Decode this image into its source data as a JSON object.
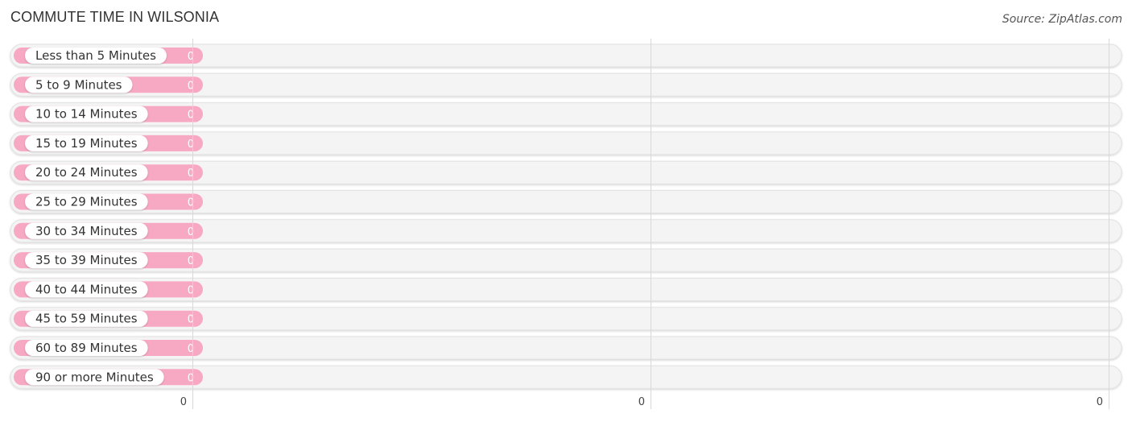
{
  "header": {
    "title": "COMMUTE TIME IN WILSONIA",
    "source": "Source: ZipAtlas.com"
  },
  "colors": {
    "bar": "#f7a8c2",
    "bar_accent": "#f08cad",
    "track": "#f4f4f4",
    "gridline": "#d8d8d8"
  },
  "chart_data": {
    "type": "bar",
    "orientation": "horizontal",
    "title": "COMMUTE TIME IN WILSONIA",
    "xlabel": "",
    "ylabel": "",
    "categories": [
      "Less than 5 Minutes",
      "5 to 9 Minutes",
      "10 to 14 Minutes",
      "15 to 19 Minutes",
      "20 to 24 Minutes",
      "25 to 29 Minutes",
      "30 to 34 Minutes",
      "35 to 39 Minutes",
      "40 to 44 Minutes",
      "45 to 59 Minutes",
      "60 to 89 Minutes",
      "90 or more Minutes"
    ],
    "values": [
      0,
      0,
      0,
      0,
      0,
      0,
      0,
      0,
      0,
      0,
      0,
      0
    ],
    "value_labels": [
      "0",
      "0",
      "0",
      "0",
      "0",
      "0",
      "0",
      "0",
      "0",
      "0",
      "0",
      "0"
    ],
    "x_ticks": [
      "0",
      "0",
      "0"
    ],
    "xlim": [
      0,
      0
    ],
    "grid": true,
    "legend": "none"
  }
}
